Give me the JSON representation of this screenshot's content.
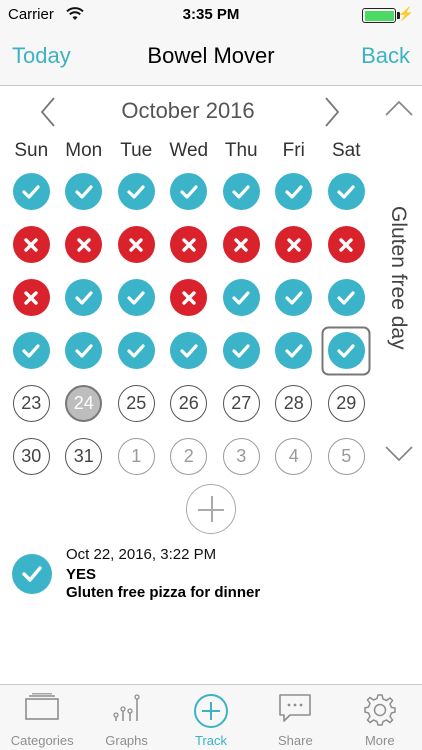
{
  "status": {
    "carrier": "Carrier",
    "time": "3:35 PM",
    "battery_percent": 100
  },
  "nav": {
    "left": "Today",
    "title": "Bowel Mover",
    "right": "Back"
  },
  "calendar": {
    "month_title": "October 2016",
    "weekdays": [
      "Sun",
      "Mon",
      "Tue",
      "Wed",
      "Thu",
      "Fri",
      "Sat"
    ],
    "weeks": [
      [
        "yes",
        "yes",
        "yes",
        "yes",
        "yes",
        "yes",
        "yes"
      ],
      [
        "no",
        "no",
        "no",
        "no",
        "no",
        "no",
        "no"
      ],
      [
        "no",
        "yes",
        "yes",
        "no",
        "yes",
        "yes",
        "yes"
      ],
      [
        "yes",
        "yes",
        "yes",
        "yes",
        "yes",
        "yes",
        "yes-selected"
      ],
      [
        "23",
        "24-today",
        "25",
        "26",
        "27",
        "28",
        "29"
      ],
      [
        "30",
        "31",
        "1-other",
        "2-other",
        "3-other",
        "4-other",
        "5-other"
      ]
    ],
    "category_label": "Gluten free day"
  },
  "entry": {
    "datetime": "Oct 22, 2016, 3:22 PM",
    "value": "YES",
    "note": "Gluten free pizza for dinner"
  },
  "tabs": [
    {
      "label": "Categories",
      "icon": "categories-icon",
      "active": false
    },
    {
      "label": "Graphs",
      "icon": "graphs-icon",
      "active": false
    },
    {
      "label": "Track",
      "icon": "track-icon",
      "active": true
    },
    {
      "label": "Share",
      "icon": "share-icon",
      "active": false
    },
    {
      "label": "More",
      "icon": "gear-icon",
      "active": false
    }
  ],
  "colors": {
    "accent": "#3bb3c3",
    "yes": "#3bb3c8",
    "no": "#d9222c"
  }
}
